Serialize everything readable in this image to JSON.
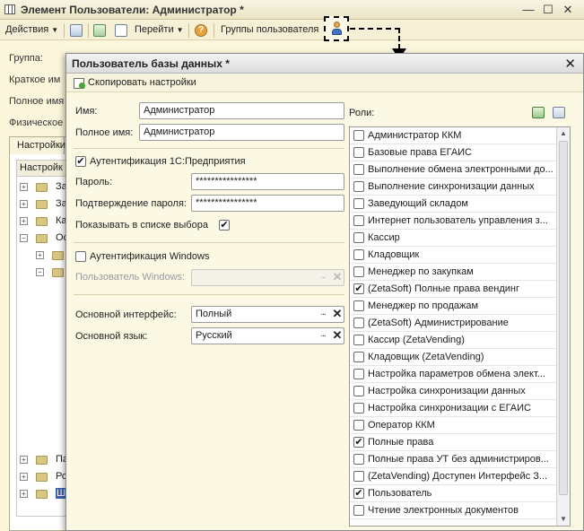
{
  "window": {
    "title": "Элемент Пользователи: Администратор *"
  },
  "toolbar": {
    "actions_label": "Действия",
    "goto_label": "Перейти",
    "user_groups_label": "Группы пользователя"
  },
  "background_form": {
    "group_label": "Группа:",
    "short_name_label": "Краткое им",
    "full_name_label": "Полное имя",
    "physical_label": "Физическое",
    "tab_label": "Настройки",
    "tree_header": "Настройк",
    "tree_rows": [
      "За",
      "За",
      "Ка",
      "Ос",
      "",
      "",
      "Па",
      "Ро",
      "Ш"
    ]
  },
  "dialog": {
    "title": "Пользователь базы данных *",
    "copy_settings_label": "Скопировать настройки",
    "name_label": "Имя:",
    "name_value": "Администратор",
    "full_name_label": "Полное имя:",
    "full_name_value": "Администратор",
    "auth_1c_label": "Аутентификация 1С:Предприятия",
    "auth_1c_checked": true,
    "password_label": "Пароль:",
    "password_value": "****************",
    "confirm_label": "Подтверждение пароля:",
    "confirm_value": "****************",
    "show_in_list_label": "Показывать в списке выбора",
    "show_in_list_checked": true,
    "auth_windows_label": "Аутентификация Windows",
    "auth_windows_checked": false,
    "windows_user_label": "Пользователь Windows:",
    "windows_user_value": "",
    "main_interface_label": "Основной интерфейс:",
    "main_interface_value": "Полный",
    "main_language_label": "Основной язык:",
    "main_language_value": "Русский",
    "roles_label": "Роли:",
    "roles": [
      {
        "label": "Администратор ККМ",
        "checked": false
      },
      {
        "label": "Базовые права ЕГАИС",
        "checked": false
      },
      {
        "label": "Выполнение обмена электронными до...",
        "checked": false
      },
      {
        "label": "Выполнение синхронизации данных",
        "checked": false
      },
      {
        "label": "Заведующий складом",
        "checked": false
      },
      {
        "label": "Интернет пользователь управления з...",
        "checked": false
      },
      {
        "label": "Кассир",
        "checked": false
      },
      {
        "label": "Кладовщик",
        "checked": false
      },
      {
        "label": "Менеджер по закупкам",
        "checked": false
      },
      {
        "label": "(ZetaSoft) Полные права вендинг",
        "checked": true
      },
      {
        "label": "Менеджер по продажам",
        "checked": false
      },
      {
        "label": "(ZetaSoft) Администрирование",
        "checked": false
      },
      {
        "label": "Кассир (ZetaVending)",
        "checked": false
      },
      {
        "label": "Кладовщик (ZetaVending)",
        "checked": false
      },
      {
        "label": "Настройка параметров обмена элект...",
        "checked": false
      },
      {
        "label": "Настройка синхронизации данных",
        "checked": false
      },
      {
        "label": "Настройка синхронизации с ЕГАИС",
        "checked": false
      },
      {
        "label": "Оператор ККМ",
        "checked": false
      },
      {
        "label": "Полные права",
        "checked": true
      },
      {
        "label": "Полные права УТ без администриров...",
        "checked": false
      },
      {
        "label": "(ZetaVending) Доступен Интерфейс З...",
        "checked": false
      },
      {
        "label": "Пользователь",
        "checked": true
      },
      {
        "label": "Чтение электронных документов",
        "checked": false
      }
    ]
  },
  "icons": {
    "check": "✔",
    "close": "✕",
    "ellipsis": "...",
    "clear": "✕",
    "minimize": "—",
    "maximize": "☐"
  }
}
